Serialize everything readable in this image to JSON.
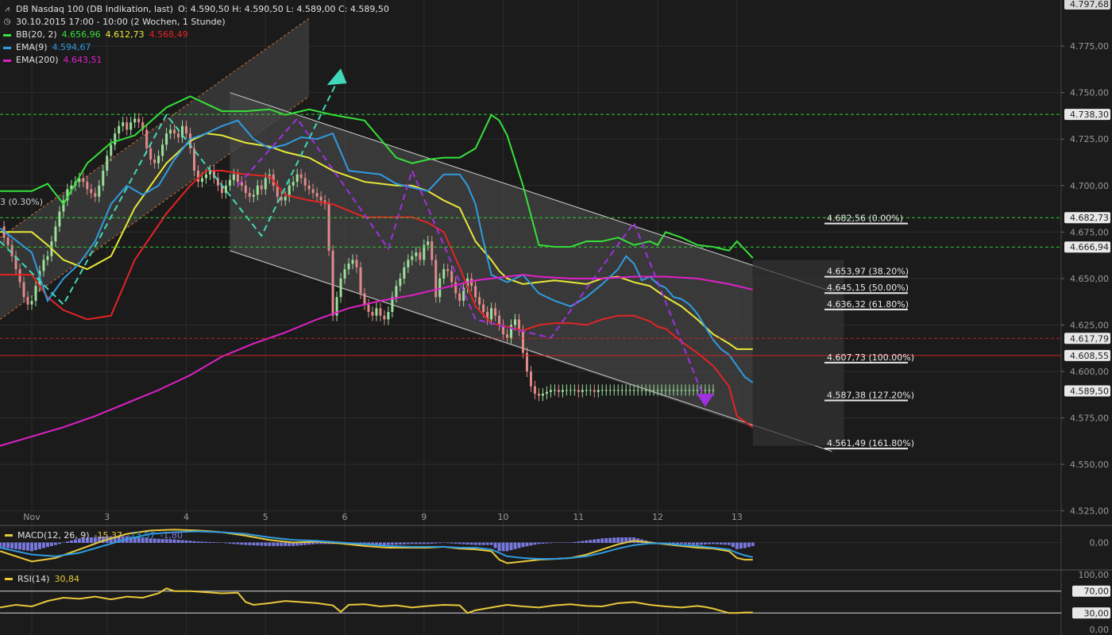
{
  "header": {
    "title": "DB Nasdaq 100 (DB Indikation, last)",
    "ohlc": "O: 4.590,50  H: 4.590,50  L: 4.589,00  C: 4.589,50",
    "period": "30.10.2015 17:00 - 10:00 (2 Wochen, 1 Stunde)",
    "indicators": [
      {
        "name": "BB(20, 2)",
        "values": [
          "4.656,96",
          "4.612,73",
          "4.568,49"
        ],
        "value_colors": [
          "#35e03a",
          "#e8e83a",
          "#e32424"
        ],
        "swatch": "#35e03a"
      },
      {
        "name": "EMA(9)",
        "values": [
          "4.594,67"
        ],
        "value_colors": [
          "#2f9be0"
        ],
        "swatch": "#2f9be0"
      },
      {
        "name": "EMA(200)",
        "values": [
          "4.643,51"
        ],
        "value_colors": [
          "#e020c8"
        ],
        "swatch": "#e020c8"
      }
    ],
    "partial_label": "3 (0.30%)"
  },
  "colors": {
    "background": "#1b1b1b",
    "grid": "#2c2c2c",
    "bb_upper": "#35e03a",
    "bb_mid": "#e8e83a",
    "bb_lower": "#e32424",
    "ema9": "#2f9be0",
    "ema200": "#e020c8",
    "candle_up": "#9be09b",
    "candle_down": "#e08a8a",
    "macd_hist": "#7777dd",
    "rsi": "#e8c83a",
    "channel_fill": "#3a3a3a",
    "trend_up_dashed": "#40d8b8",
    "trend_down_dashed": "#a030e0",
    "hline_green": "#33cc33",
    "hline_red": "#cc2222"
  },
  "chart_data": {
    "type": "line",
    "price_axis": {
      "ylim": [
        4518,
        4797.68
      ],
      "ticks": [
        "4.775,00",
        "4.750,00",
        "4.725,00",
        "4.700,00",
        "4.675,00",
        "4.650,00",
        "4.625,00",
        "4.600,00",
        "4.575,00",
        "4.550,00",
        "4.525,00"
      ],
      "tick_values": [
        4775,
        4750,
        4725,
        4700,
        4675,
        4650,
        4625,
        4600,
        4575,
        4550,
        4525
      ],
      "top_label": "4.797,68",
      "top_value": 4797.68
    },
    "x_axis": {
      "labels": [
        "Nov",
        "3",
        "4",
        "5",
        "6",
        "9",
        "10",
        "11",
        "12",
        "13"
      ],
      "label_pos": [
        0,
        19,
        39,
        59,
        79,
        99,
        119,
        138,
        158,
        178
      ],
      "xlim": [
        -8,
        182
      ]
    },
    "price_markers": [
      {
        "label": "4.738,30",
        "value": 4738.3,
        "style": "green-dashed"
      },
      {
        "label": "4.682,73",
        "value": 4682.73,
        "style": "green-dashed"
      },
      {
        "label": "4.666,94",
        "value": 4666.94,
        "style": "green-dashed"
      },
      {
        "label": "4.617,79",
        "value": 4617.79,
        "style": "red-dashed"
      },
      {
        "label": "4.608,55",
        "value": 4608.55,
        "style": "red-solid"
      },
      {
        "label": "4.589,50",
        "value": 4589.5,
        "style": "current"
      }
    ],
    "fibonacci": [
      {
        "label": "4.682,56 (0.00%)",
        "value": 4682.56
      },
      {
        "label": "4.653,97 (38.20%)",
        "value": 4653.97
      },
      {
        "label": "4.645,15 (50.00%)",
        "value": 4645.15
      },
      {
        "label": "4.636,32 (61.80%)",
        "value": 4636.32
      },
      {
        "label": "4.607,73 (100.00%)",
        "value": 4607.73
      },
      {
        "label": "4.587,38 (127.20%)",
        "value": 4587.38
      },
      {
        "label": "4.561,49 (161.80%)",
        "value": 4561.49
      }
    ],
    "series": [
      {
        "name": "BB(20, 2)",
        "key": "bb_upper",
        "x": [
          -8,
          0,
          4,
          8,
          14,
          20,
          26,
          34,
          40,
          44,
          48,
          54,
          60,
          64,
          70,
          76,
          84,
          92,
          96,
          100,
          104,
          108,
          112,
          116,
          118,
          120,
          124,
          128,
          132,
          136,
          140,
          144,
          148,
          152,
          156,
          158,
          160,
          164,
          168,
          172,
          176,
          178,
          182
        ],
        "y": [
          4697,
          4697,
          4701,
          4690,
          4712,
          4723,
          4727,
          4742,
          4748,
          4744,
          4740,
          4740,
          4741,
          4738,
          4741,
          4738,
          4735,
          4715,
          4712,
          4714,
          4715,
          4715,
          4720,
          4738,
          4735,
          4727,
          4700,
          4668,
          4667,
          4667,
          4670,
          4670,
          4672,
          4668,
          4670,
          4668,
          4675,
          4672,
          4668,
          4667,
          4665,
          4670,
          4661
        ]
      },
      {
        "name": "BB(20, 2)",
        "key": "bb_mid",
        "x": [
          -8,
          0,
          4,
          8,
          14,
          20,
          26,
          34,
          40,
          44,
          48,
          54,
          60,
          64,
          70,
          76,
          84,
          92,
          96,
          100,
          104,
          108,
          112,
          116,
          118,
          120,
          124,
          128,
          132,
          136,
          140,
          144,
          148,
          152,
          156,
          158,
          160,
          164,
          168,
          172,
          176,
          178,
          182
        ],
        "y": [
          4675,
          4675,
          4668,
          4660,
          4655,
          4662,
          4688,
          4712,
          4724,
          4728,
          4727,
          4723,
          4721,
          4718,
          4715,
          4708,
          4702,
          4700,
          4700,
          4697,
          4692,
          4688,
          4670,
          4660,
          4654,
          4650,
          4647,
          4648,
          4649,
          4648,
          4647,
          4650,
          4651,
          4648,
          4646,
          4643,
          4640,
          4635,
          4628,
          4620,
          4615,
          4612,
          4612
        ]
      },
      {
        "name": "BB(20, 2)",
        "key": "bb_lower",
        "x": [
          -8,
          0,
          4,
          8,
          14,
          20,
          26,
          34,
          40,
          44,
          48,
          54,
          60,
          64,
          70,
          76,
          84,
          92,
          96,
          100,
          104,
          108,
          112,
          116,
          118,
          120,
          124,
          128,
          132,
          136,
          140,
          144,
          148,
          152,
          156,
          158,
          160,
          164,
          168,
          172,
          176,
          178,
          182
        ],
        "y": [
          4652,
          4652,
          4640,
          4633,
          4628,
          4630,
          4660,
          4685,
          4700,
          4708,
          4708,
          4706,
          4705,
          4695,
          4692,
          4690,
          4683,
          4683,
          4683,
          4680,
          4675,
          4656,
          4635,
          4626,
          4625,
          4624,
          4622,
          4625,
          4626,
          4626,
          4625,
          4628,
          4630,
          4630,
          4627,
          4624,
          4623,
          4616,
          4610,
          4603,
          4592,
          4576,
          4570
        ]
      },
      {
        "name": "EMA(9)",
        "key": "ema9",
        "x": [
          -8,
          0,
          4,
          8,
          12,
          16,
          20,
          24,
          28,
          32,
          36,
          40,
          44,
          48,
          52,
          56,
          60,
          64,
          68,
          72,
          76,
          80,
          84,
          88,
          92,
          96,
          100,
          104,
          108,
          110,
          112,
          114,
          116,
          118,
          120,
          124,
          128,
          132,
          136,
          140,
          144,
          148,
          150,
          152,
          154,
          156,
          158,
          160,
          162,
          164,
          166,
          168,
          170,
          172,
          174,
          176,
          178,
          180,
          182
        ],
        "y": [
          4677,
          4664,
          4638,
          4650,
          4658,
          4670,
          4690,
          4700,
          4695,
          4700,
          4714,
          4725,
          4728,
          4732,
          4735,
          4725,
          4720,
          4722,
          4726,
          4725,
          4728,
          4708,
          4707,
          4706,
          4701,
          4699,
          4697,
          4706,
          4706,
          4700,
          4690,
          4670,
          4652,
          4650,
          4648,
          4652,
          4642,
          4638,
          4635,
          4640,
          4647,
          4655,
          4662,
          4658,
          4649,
          4651,
          4647,
          4645,
          4640,
          4639,
          4636,
          4631,
          4624,
          4617,
          4612,
          4609,
          4603,
          4597,
          4594
        ]
      },
      {
        "name": "EMA(200)",
        "key": "ema200",
        "x": [
          -8,
          0,
          8,
          16,
          24,
          32,
          40,
          48,
          56,
          64,
          72,
          80,
          88,
          96,
          104,
          112,
          120,
          124,
          128,
          136,
          144,
          152,
          160,
          168,
          176,
          182
        ],
        "y": [
          4560,
          4565,
          4570,
          4576,
          4583,
          4590,
          4598,
          4608,
          4615,
          4621,
          4628,
          4634,
          4638,
          4641,
          4645,
          4649,
          4651,
          4652,
          4651,
          4650,
          4650,
          4651,
          4651,
          4650,
          4647,
          4644
        ]
      }
    ],
    "candles": {
      "x": [
        -8,
        -7,
        -6,
        -5,
        -4,
        -3,
        -2,
        -1,
        0,
        1,
        2,
        3,
        4,
        5,
        6,
        7,
        8,
        9,
        10,
        11,
        12,
        13,
        14,
        15,
        16,
        17,
        18,
        19,
        20,
        21,
        22,
        23,
        24,
        25,
        26,
        27,
        28,
        29,
        30,
        31,
        32,
        33,
        34,
        35,
        36,
        37,
        38,
        39,
        40,
        41,
        42,
        43,
        44,
        45,
        46,
        47,
        48,
        49,
        50,
        51,
        52,
        53,
        54,
        55,
        56,
        57,
        58,
        59,
        60,
        61,
        62,
        63,
        64,
        65,
        66,
        67,
        68,
        69,
        70,
        71,
        72,
        73,
        74,
        75,
        76,
        77,
        78,
        79,
        80,
        81,
        82,
        83,
        84,
        85,
        86,
        87,
        88,
        89,
        90,
        91,
        92,
        93,
        94,
        95,
        96,
        97,
        98,
        99,
        100,
        101,
        102,
        103,
        104,
        105,
        106,
        107,
        108,
        109,
        110,
        111,
        112,
        113,
        114,
        115,
        116,
        117,
        118,
        119,
        120,
        121,
        122,
        123,
        124,
        125,
        126,
        127,
        128,
        129,
        130,
        131,
        132,
        133,
        134,
        135,
        136,
        137,
        138,
        139,
        140,
        141,
        142,
        143,
        144,
        145,
        146,
        147,
        148,
        149,
        150,
        151,
        152,
        153,
        154,
        155,
        156,
        157,
        158,
        159,
        160,
        161,
        162,
        163,
        164,
        165,
        166,
        167,
        168,
        169,
        170,
        171,
        172,
        173,
        174,
        175,
        176,
        177,
        178,
        179,
        180
      ],
      "close": [
        4678,
        4672,
        4668,
        4662,
        4655,
        4648,
        4640,
        4636,
        4638,
        4646,
        4654,
        4660,
        4662,
        4670,
        4678,
        4686,
        4692,
        4698,
        4700,
        4702,
        4704,
        4702,
        4698,
        4696,
        4694,
        4700,
        4708,
        4716,
        4722,
        4728,
        4732,
        4734,
        4730,
        4734,
        4736,
        4734,
        4730,
        4720,
        4714,
        4712,
        4716,
        4722,
        4728,
        4730,
        4728,
        4726,
        4732,
        4728,
        4720,
        4708,
        4702,
        4704,
        4706,
        4708,
        4704,
        4700,
        4696,
        4700,
        4703,
        4706,
        4702,
        4700,
        4696,
        4694,
        4695,
        4700,
        4698,
        4704,
        4706,
        4700,
        4694,
        4692,
        4694,
        4700,
        4702,
        4706,
        4704,
        4700,
        4698,
        4696,
        4694,
        4692,
        4690,
        4665,
        4630,
        4640,
        4650,
        4655,
        4658,
        4660,
        4656,
        4642,
        4636,
        4632,
        4630,
        4634,
        4630,
        4628,
        4632,
        4640,
        4646,
        4650,
        4656,
        4660,
        4662,
        4664,
        4660,
        4668,
        4670,
        4660,
        4640,
        4650,
        4655,
        4654,
        4648,
        4642,
        4638,
        4645,
        4650,
        4646,
        4640,
        4636,
        4632,
        4628,
        4634,
        4630,
        4625,
        4620,
        4618,
        4625,
        4628,
        4622,
        4610,
        4600,
        4592,
        4588,
        4587,
        4588,
        4589,
        4590,
        4590,
        4589,
        4590,
        4590,
        4590,
        4590,
        4589,
        4590,
        4590,
        4590,
        4589,
        4590,
        4590,
        4590,
        4590,
        4590,
        4590,
        4590,
        4590,
        4590,
        4590,
        4590,
        4590,
        4590,
        4590,
        4590,
        4590,
        4590,
        4590,
        4590,
        4590,
        4590,
        4590,
        4590,
        4590,
        4590,
        4590,
        4590,
        4590,
        4590,
        4590
      ]
    },
    "macd": {
      "label": "MACD(12, 26, 9)",
      "values": [
        "-15,37",
        "-13,57",
        "-1,80"
      ],
      "value_colors": [
        "#e8c83a",
        "#2f9be0",
        "#7777dd"
      ],
      "ticks": [
        "0,00"
      ],
      "ylim": [
        -30,
        18
      ],
      "x": [
        -8,
        0,
        6,
        12,
        18,
        24,
        30,
        36,
        42,
        48,
        54,
        60,
        66,
        72,
        78,
        84,
        90,
        96,
        100,
        104,
        108,
        112,
        116,
        118,
        120,
        124,
        128,
        132,
        136,
        140,
        144,
        148,
        152,
        156,
        160,
        164,
        168,
        172,
        176,
        178,
        180,
        182
      ],
      "macd_line": [
        -10,
        -22,
        -18,
        -8,
        2,
        10,
        14,
        15,
        14,
        12,
        8,
        3,
        0,
        1,
        -1,
        -4,
        -6,
        -6,
        -6,
        -5,
        -7,
        -8,
        -10,
        -20,
        -24,
        -22,
        -20,
        -19,
        -18,
        -14,
        -8,
        -2,
        2,
        0,
        -2,
        -4,
        -6,
        -7,
        -10,
        -18,
        -20,
        -20
      ],
      "signal_line": [
        -6,
        -14,
        -16,
        -12,
        -4,
        4,
        10,
        12,
        13,
        12,
        10,
        6,
        3,
        2,
        0,
        -2,
        -4,
        -5,
        -5,
        -5,
        -6,
        -6,
        -8,
        -12,
        -16,
        -18,
        -19,
        -19,
        -18,
        -16,
        -12,
        -7,
        -3,
        -1,
        -1,
        -3,
        -4,
        -6,
        -8,
        -12,
        -15,
        -17
      ]
    },
    "rsi": {
      "label": "RSI(14)",
      "value": "30,84",
      "ticks": [
        "100,00",
        "70,00",
        "30,00",
        "0,00"
      ],
      "tick_values": [
        100,
        70,
        30,
        0
      ],
      "ylim": [
        0,
        100
      ],
      "x": [
        -8,
        -4,
        0,
        4,
        8,
        12,
        16,
        20,
        24,
        28,
        32,
        34,
        36,
        40,
        44,
        48,
        52,
        54,
        56,
        60,
        64,
        68,
        72,
        76,
        78,
        80,
        84,
        88,
        92,
        96,
        100,
        104,
        108,
        110,
        112,
        116,
        120,
        124,
        128,
        132,
        136,
        140,
        144,
        148,
        152,
        156,
        160,
        164,
        168,
        170,
        172,
        174,
        176,
        178,
        180,
        182
      ],
      "y": [
        40,
        45,
        42,
        52,
        58,
        56,
        60,
        55,
        60,
        58,
        66,
        75,
        70,
        70,
        68,
        66,
        67,
        50,
        45,
        48,
        52,
        50,
        48,
        44,
        32,
        45,
        46,
        42,
        44,
        40,
        43,
        45,
        44,
        30,
        35,
        40,
        45,
        42,
        40,
        44,
        46,
        43,
        42,
        48,
        50,
        45,
        42,
        40,
        43,
        41,
        38,
        34,
        30,
        30,
        31,
        31
      ]
    }
  }
}
